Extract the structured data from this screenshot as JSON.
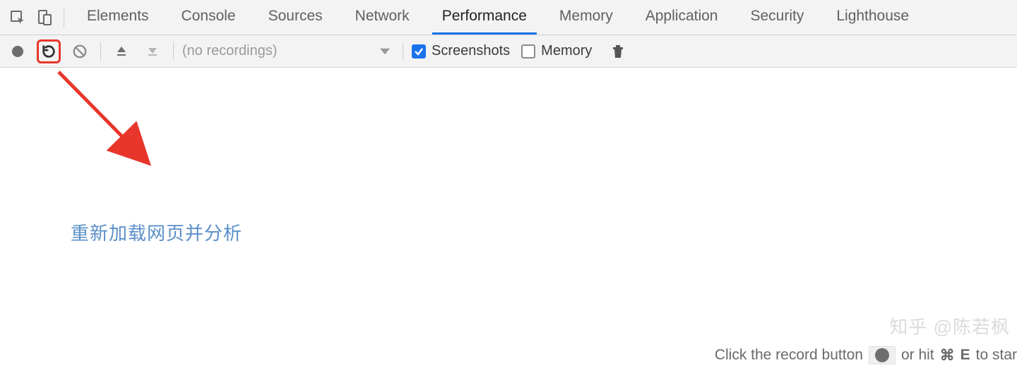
{
  "tabs": {
    "items": [
      {
        "label": "Elements"
      },
      {
        "label": "Console"
      },
      {
        "label": "Sources"
      },
      {
        "label": "Network"
      },
      {
        "label": "Performance"
      },
      {
        "label": "Memory"
      },
      {
        "label": "Application"
      },
      {
        "label": "Security"
      },
      {
        "label": "Lighthouse"
      }
    ],
    "active_index": 4
  },
  "toolbar": {
    "recordings_placeholder": "(no recordings)",
    "screenshots_label": "Screenshots",
    "screenshots_checked": true,
    "memory_label": "Memory",
    "memory_checked": false
  },
  "annotation": {
    "text": "重新加载网页并分析"
  },
  "hint": {
    "prefix": "Click the record button",
    "middle": "or hit",
    "cmd_symbol": "⌘",
    "key": "E",
    "suffix": "to star"
  },
  "watermark": "知乎 @陈若枫"
}
